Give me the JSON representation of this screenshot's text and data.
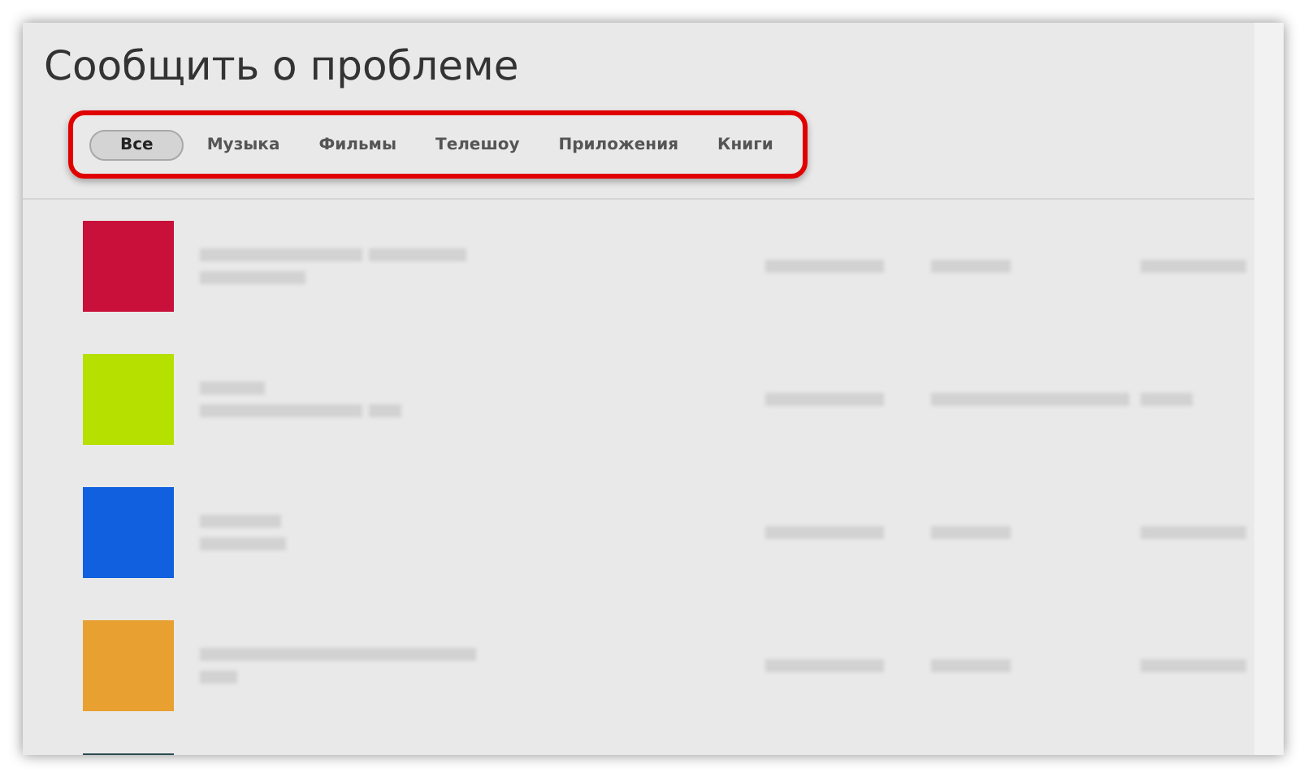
{
  "window": {
    "title": "Сообщить о проблеме"
  },
  "tabs": [
    {
      "label": "Все",
      "selected": true
    },
    {
      "label": "Музыка",
      "selected": false
    },
    {
      "label": "Фильмы",
      "selected": false
    },
    {
      "label": "Телешоу",
      "selected": false
    },
    {
      "label": "Приложения",
      "selected": false
    },
    {
      "label": "Книги",
      "selected": false
    }
  ],
  "rows": [
    {
      "color": "#c8103a"
    },
    {
      "color": "#b5e000"
    },
    {
      "color": "#1060e0"
    },
    {
      "color": "#e8a030"
    },
    {
      "color": "#2a4a50"
    }
  ]
}
